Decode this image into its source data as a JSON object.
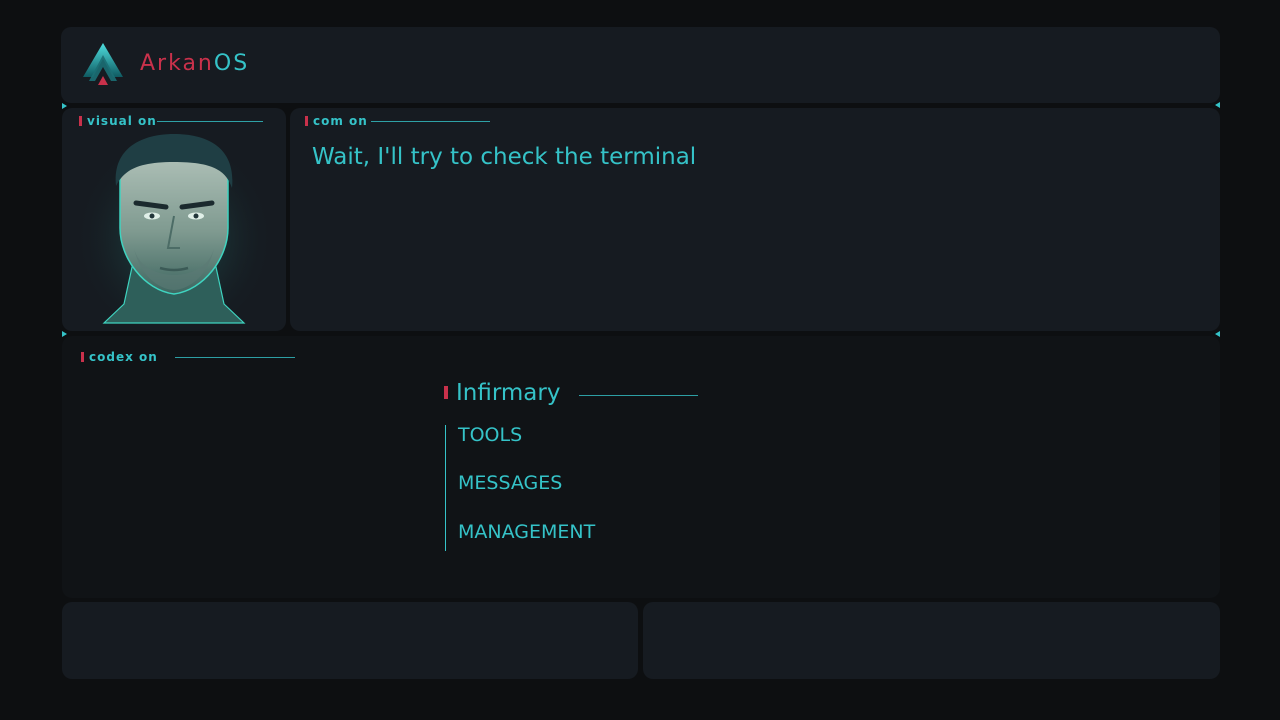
{
  "brand": {
    "name_part1": "Arkan",
    "name_part2": "OS"
  },
  "visual": {
    "label": "visual on",
    "portrait": "man-portrait"
  },
  "com": {
    "label": "com on",
    "message": "Wait, I'll try to check the terminal"
  },
  "codex": {
    "label": "codex on",
    "menu_title": "Infirmary",
    "items": [
      "TOOLS",
      "MESSAGES",
      "MANAGEMENT"
    ]
  },
  "colors": {
    "accent": "#35c3c8",
    "brand_red": "#c9314b",
    "panel": "#161b21",
    "background": "#0d0f11"
  }
}
